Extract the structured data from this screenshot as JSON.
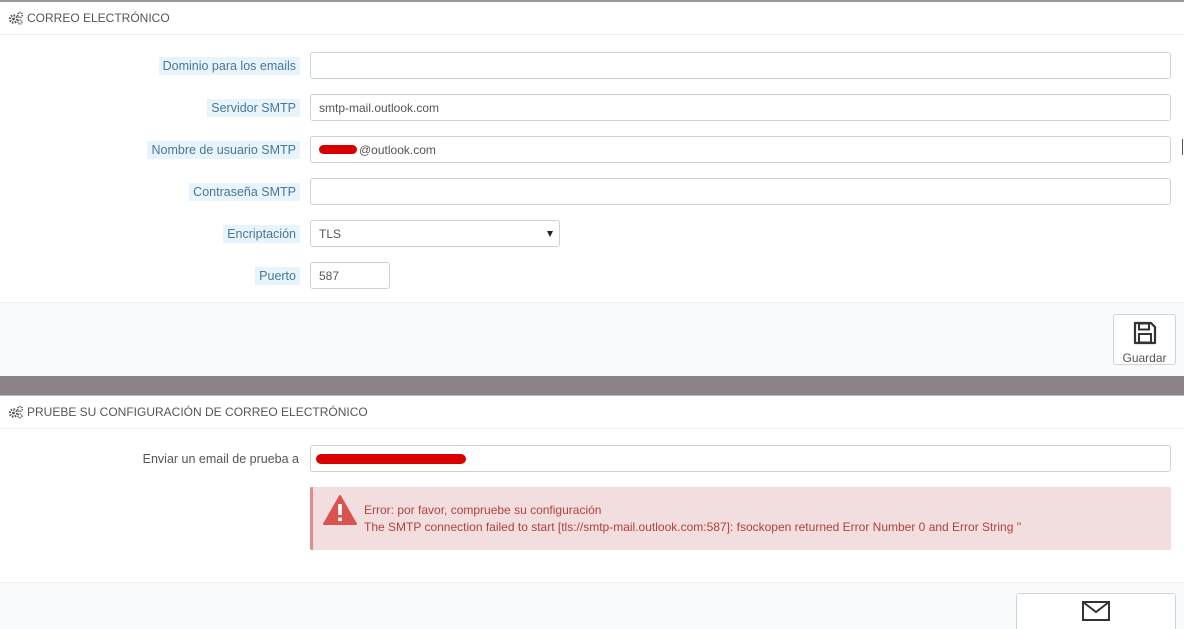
{
  "email_section": {
    "title": "CORREO ELECTRÓNICO",
    "fields": {
      "domain": {
        "label": "Dominio para los emails",
        "value": ""
      },
      "smtp_server": {
        "label": "Servidor SMTP",
        "value": "smtp-mail.outlook.com"
      },
      "smtp_user": {
        "label": "Nombre de usuario SMTP",
        "value_suffix": "@outlook.com"
      },
      "smtp_password": {
        "label": "Contraseña SMTP",
        "value": ""
      },
      "encryption": {
        "label": "Encriptación",
        "value": "TLS"
      },
      "port": {
        "label": "Puerto",
        "value": "587"
      }
    },
    "save_button": {
      "label": "Guardar",
      "icon": "floppy-disk-icon"
    }
  },
  "test_section": {
    "title": "PRUEBE SU CONFIGURACIÓN DE CORREO ELECTRÓNICO",
    "send_to": {
      "label": "Enviar un email de prueba a"
    },
    "error": {
      "line1": "Error: por favor, compruebe su configuración",
      "line2": "The SMTP connection failed to start [tls://smtp-mail.outlook.com:587]: fsockopen returned Error Number 0 and Error String ''"
    },
    "send_button": {
      "icon": "envelope-icon"
    }
  },
  "colors": {
    "label_bg": "#e8f4fb",
    "label_text": "#4a7894",
    "error_bg": "#f2dede",
    "error_text": "#b0413e",
    "redaction": "#d80000"
  }
}
